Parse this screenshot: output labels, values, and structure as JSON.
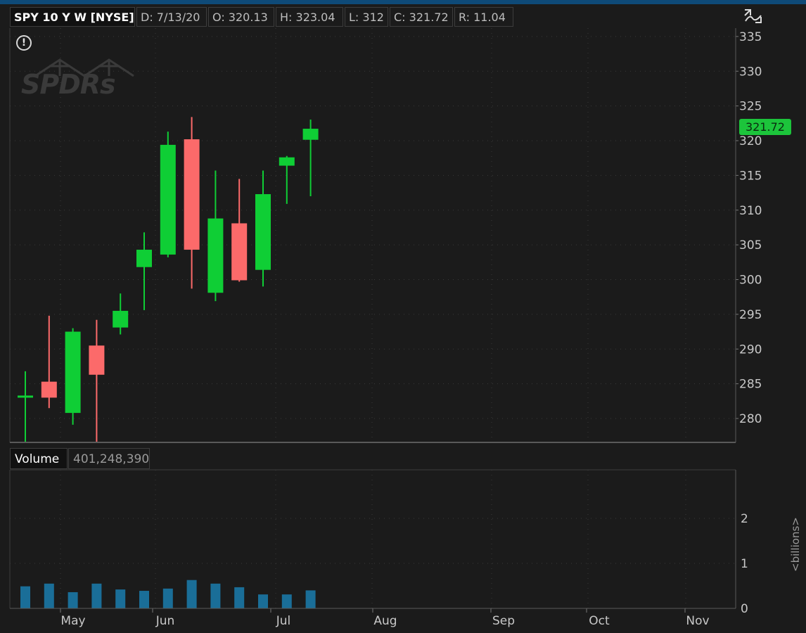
{
  "header": {
    "symbol": "SPY 10 Y W [NYSE]",
    "date": "D: 7/13/20",
    "open": "O: 320.13",
    "high": "H: 323.04",
    "low": "L: 312",
    "close": "C: 321.72",
    "range": "R: 11.04"
  },
  "logo_text": "SPDRs",
  "volume_panel": {
    "label": "Volume",
    "value": "401,248,390",
    "units": "<billions>"
  },
  "last_price_label": "321.72",
  "colors": {
    "up": "#0fce35",
    "down": "#fc6a6a",
    "volume": "#1a6e98",
    "grid": "#3a3a3a",
    "background": "#1b1b1b"
  },
  "chart_data": [
    {
      "type": "candlestick",
      "ylim": [
        276.5,
        337
      ],
      "yticks": [
        280,
        285,
        290,
        295,
        300,
        305,
        310,
        315,
        320,
        325,
        330,
        335
      ],
      "x_month_labels": [
        "May",
        "Jun",
        "Jul",
        "Aug",
        "Sep",
        "Oct",
        "Nov"
      ],
      "grid": true,
      "candles": [
        {
          "o": 283.0,
          "h": 286.8,
          "l": 276.5,
          "c": 283.3
        },
        {
          "o": 285.3,
          "h": 294.8,
          "l": 281.5,
          "c": 283.0
        },
        {
          "o": 280.8,
          "h": 293.0,
          "l": 279.1,
          "c": 292.5
        },
        {
          "o": 290.5,
          "h": 294.2,
          "l": 276.5,
          "c": 286.3
        },
        {
          "o": 293.1,
          "h": 298.0,
          "l": 292.1,
          "c": 295.5
        },
        {
          "o": 301.8,
          "h": 306.8,
          "l": 295.6,
          "c": 304.3
        },
        {
          "o": 303.6,
          "h": 321.3,
          "l": 303.2,
          "c": 319.4
        },
        {
          "o": 320.2,
          "h": 323.4,
          "l": 298.7,
          "c": 304.3
        },
        {
          "o": 298.1,
          "h": 315.7,
          "l": 296.9,
          "c": 308.8
        },
        {
          "o": 308.1,
          "h": 314.5,
          "l": 299.7,
          "c": 299.9
        },
        {
          "o": 301.4,
          "h": 315.7,
          "l": 299.0,
          "c": 312.3
        },
        {
          "o": 316.4,
          "h": 317.8,
          "l": 310.9,
          "c": 317.6
        },
        {
          "o": 320.13,
          "h": 323.04,
          "l": 312.0,
          "c": 321.72
        }
      ]
    },
    {
      "type": "bar",
      "title": "Volume",
      "ylabel": "<billions>",
      "ylim": [
        0,
        3
      ],
      "yticks": [
        0,
        1,
        2
      ],
      "values": [
        0.49,
        0.55,
        0.36,
        0.55,
        0.42,
        0.39,
        0.44,
        0.63,
        0.55,
        0.47,
        0.31,
        0.31,
        0.4
      ]
    }
  ]
}
